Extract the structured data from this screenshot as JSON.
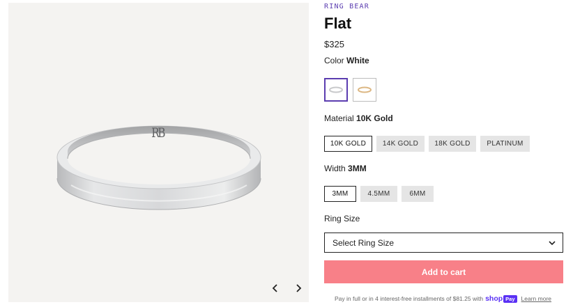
{
  "gallery": {
    "prev_icon": "chevron-left-icon",
    "next_icon": "chevron-right-icon",
    "ring_engraving": "RB"
  },
  "product": {
    "brand": "RING BEAR",
    "title": "Flat",
    "price": "$325"
  },
  "color": {
    "label": "Color",
    "selected": "White",
    "swatches": [
      {
        "name": "White",
        "color": "#c8c9cb",
        "selected": true
      },
      {
        "name": "Yellow",
        "color": "#dcb783",
        "selected": false
      }
    ]
  },
  "material": {
    "label": "Material",
    "selected": "10K Gold",
    "options": [
      "10K GOLD",
      "14K GOLD",
      "18K GOLD",
      "PLATINUM"
    ]
  },
  "width": {
    "label": "Width",
    "selected": "3MM",
    "options": [
      "3MM",
      "4.5MM",
      "6MM"
    ]
  },
  "ring_size": {
    "label": "Ring Size",
    "placeholder": "Select Ring Size"
  },
  "cart": {
    "button_label": "Add to cart"
  },
  "installments": {
    "text": "Pay in full or in 4 interest-free installments of $81.25 with",
    "shop": "shop",
    "pay": "Pay",
    "learn_more": "Learn more"
  },
  "colors": {
    "accent": "#5b3db0",
    "cart_button": "#f88088",
    "shop_pay": "#5a31f4"
  }
}
